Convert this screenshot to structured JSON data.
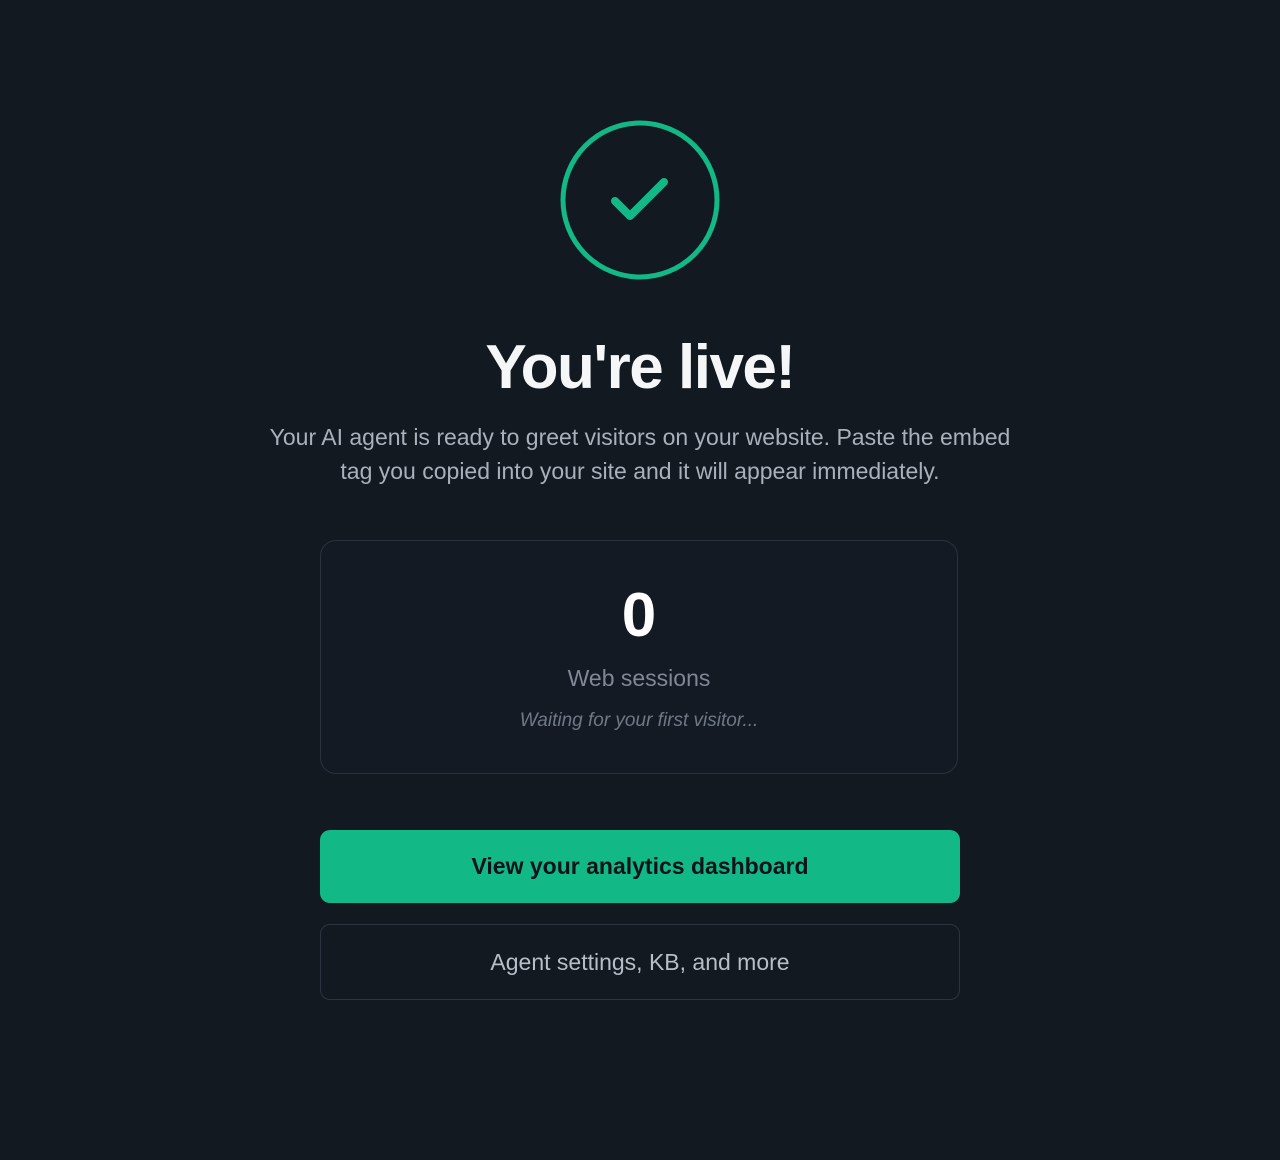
{
  "hero": {
    "icon": "check-circle-icon",
    "accent_color": "#12b886",
    "title": "You're live!",
    "subtitle": "Your AI agent is ready to greet visitors on your website. Paste the embed tag you copied into your site and it will appear immediately."
  },
  "stats": {
    "value": "0",
    "label": "Web sessions",
    "note": "Waiting for your first visitor..."
  },
  "actions": {
    "primary_label": "View your analytics dashboard",
    "secondary_label": "Agent settings, KB, and more"
  },
  "colors": {
    "background": "#121921",
    "primary_button": "#12b886"
  }
}
